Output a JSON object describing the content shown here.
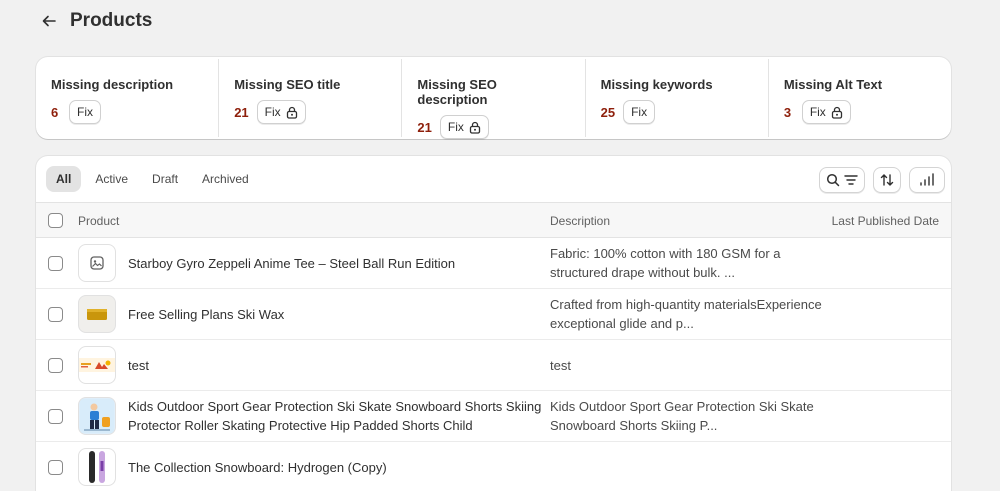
{
  "header": {
    "title": "Products"
  },
  "issues": [
    {
      "title": "Missing description",
      "count": "6",
      "fix_label": "Fix",
      "locked": false
    },
    {
      "title": "Missing SEO title",
      "count": "21",
      "fix_label": "Fix",
      "locked": true
    },
    {
      "title": "Missing SEO description",
      "count": "21",
      "fix_label": "Fix",
      "locked": true
    },
    {
      "title": "Missing keywords",
      "count": "25",
      "fix_label": "Fix",
      "locked": false
    },
    {
      "title": "Missing Alt Text",
      "count": "3",
      "fix_label": "Fix",
      "locked": true
    }
  ],
  "tabs": [
    {
      "label": "All",
      "active": true
    },
    {
      "label": "Active",
      "active": false
    },
    {
      "label": "Draft",
      "active": false
    },
    {
      "label": "Archived",
      "active": false
    }
  ],
  "toolbar": {
    "search_icon": "search-icon",
    "filter_icon": "filter-icon",
    "sort_icon": "sort-icon",
    "columns_icon": "columns-icon"
  },
  "columns": {
    "product": "Product",
    "description": "Description",
    "last_published": "Last Published Date"
  },
  "products": [
    {
      "name": "Starboy Gyro Zeppeli Anime Tee – Steel Ball Run Edition",
      "description": "Fabric: 100% cotton with 180 GSM for a structured drape without bulk. ...",
      "date": "",
      "thumb": "placeholder-image-icon"
    },
    {
      "name": "Free Selling Plans Ski Wax",
      "description": "Crafted from high-quantity materialsExperience exceptional glide and p...",
      "date": "",
      "thumb": "ski-wax-image"
    },
    {
      "name": "test",
      "description": "test",
      "date": "",
      "thumb": "banner-image"
    },
    {
      "name": "Kids Outdoor Sport Gear Protection Ski Skate Snowboard Shorts Skiing Protector Roller Skating Protective Hip Padded Shorts Child",
      "description": "Kids Outdoor Sport Gear Protection Ski Skate Snowboard Shorts Skiing P...",
      "date": "",
      "thumb": "kids-gear-image"
    },
    {
      "name": "The Collection Snowboard: Hydrogen (Copy)",
      "description": "",
      "date": "",
      "thumb": "snowboard-image"
    }
  ],
  "colors": {
    "count_red": "#8e1f0b",
    "background": "#f1f1f1",
    "card": "#ffffff"
  }
}
